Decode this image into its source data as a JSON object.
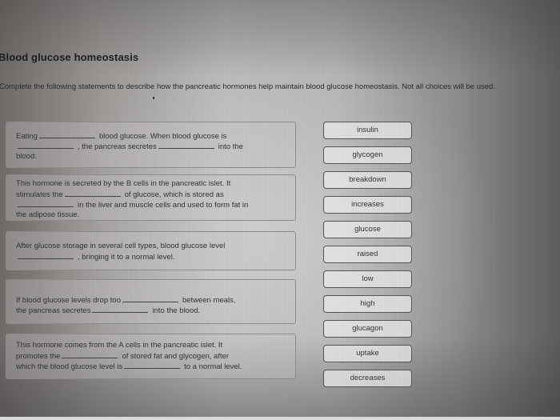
{
  "page": {
    "title": "Blood glucose homeostasis",
    "instructions": "Complete the following statements to describe how the pancreatic hormones help maintain blood glucose homeostasis. Not all choices will be used."
  },
  "statements": [
    {
      "lines": [
        [
          "Eating",
          "__BLANK__",
          "blood glucose. When blood glucose is"
        ],
        [
          "__BLANK__",
          ", the pancreas secretes",
          "__BLANK__",
          "into the"
        ],
        [
          "blood."
        ]
      ]
    },
    {
      "lines": [
        [
          "This hormone is secreted by the B cells in the pancreatic islet. It"
        ],
        [
          "stimulates the",
          "__BLANK__",
          "of glucose, which is stored as"
        ],
        [
          "__BLANK__",
          "in the liver and muscle cells and used to form fat in"
        ],
        [
          "the adipose tissue."
        ]
      ]
    },
    {
      "lines": [
        [
          "After glucose storage in several cell types, blood glucose level"
        ],
        [
          "__BLANK__",
          ", bringing it to a normal level."
        ]
      ]
    },
    {
      "lines": [
        [
          "If blood glucose levels drop too",
          "__BLANK__",
          "between meals,"
        ],
        [
          "the pancreas secretes",
          "__BLANK__",
          "into the blood."
        ]
      ]
    },
    {
      "lines": [
        [
          "This hormone comes from the A cells in the pancreatic islet. It"
        ],
        [
          "promotes the",
          "__BLANK__",
          "of stored fat and glycogen, after"
        ],
        [
          "which the blood glucose level is",
          "__BLANK__",
          "to a normal level."
        ]
      ]
    }
  ],
  "choices": [
    {
      "label": "insulin"
    },
    {
      "label": "glycogen"
    },
    {
      "label": "breakdown"
    },
    {
      "label": "increases"
    },
    {
      "label": "glucose"
    },
    {
      "label": "raised"
    },
    {
      "label": "low"
    },
    {
      "label": "high"
    },
    {
      "label": "glucagon"
    },
    {
      "label": "uptake"
    },
    {
      "label": "decreases"
    }
  ]
}
